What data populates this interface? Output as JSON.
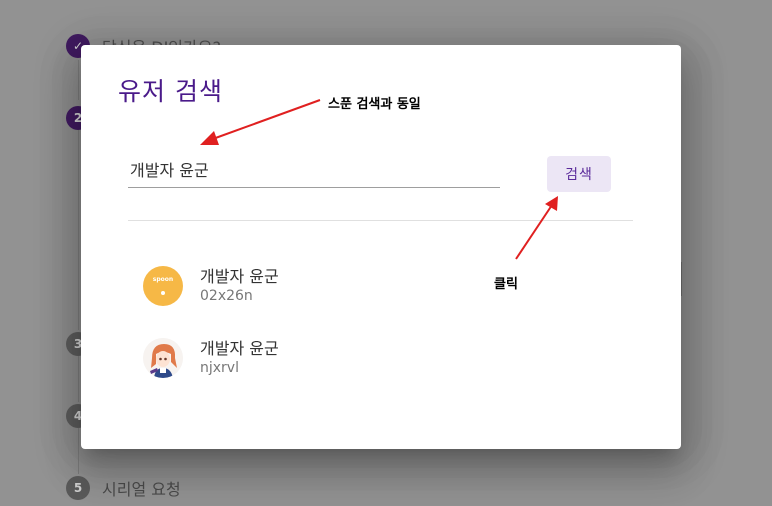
{
  "background": {
    "steps": [
      {
        "number": "✓",
        "label": "당신은 DJ인가요?",
        "state": "done"
      },
      {
        "number": "2",
        "label": "",
        "state": "active"
      },
      {
        "number": "3",
        "label": "",
        "state": "inactive"
      },
      {
        "number": "4",
        "label": "",
        "state": "inactive"
      },
      {
        "number": "5",
        "label": "시리얼 요청",
        "state": "inactive"
      }
    ]
  },
  "dialog": {
    "title": "유저 검색",
    "search_value": "개발자 윤군",
    "search_button": "검색",
    "results": [
      {
        "nickname": "개발자 윤군",
        "tag": "02x26n",
        "avatar": "spoon-logo-avatar",
        "avatar_text": "spoon"
      },
      {
        "nickname": "개발자 윤군",
        "tag": "njxrvl",
        "avatar": "anime-character-avatar"
      }
    ]
  },
  "annotations": {
    "note_search": "스푼 검색과 동일",
    "note_click": "클릭",
    "arrow_color": "#e02020"
  },
  "colors": {
    "accent": "#4a1a8a",
    "button_bg": "#ece6f5",
    "overlay": "#929292"
  }
}
